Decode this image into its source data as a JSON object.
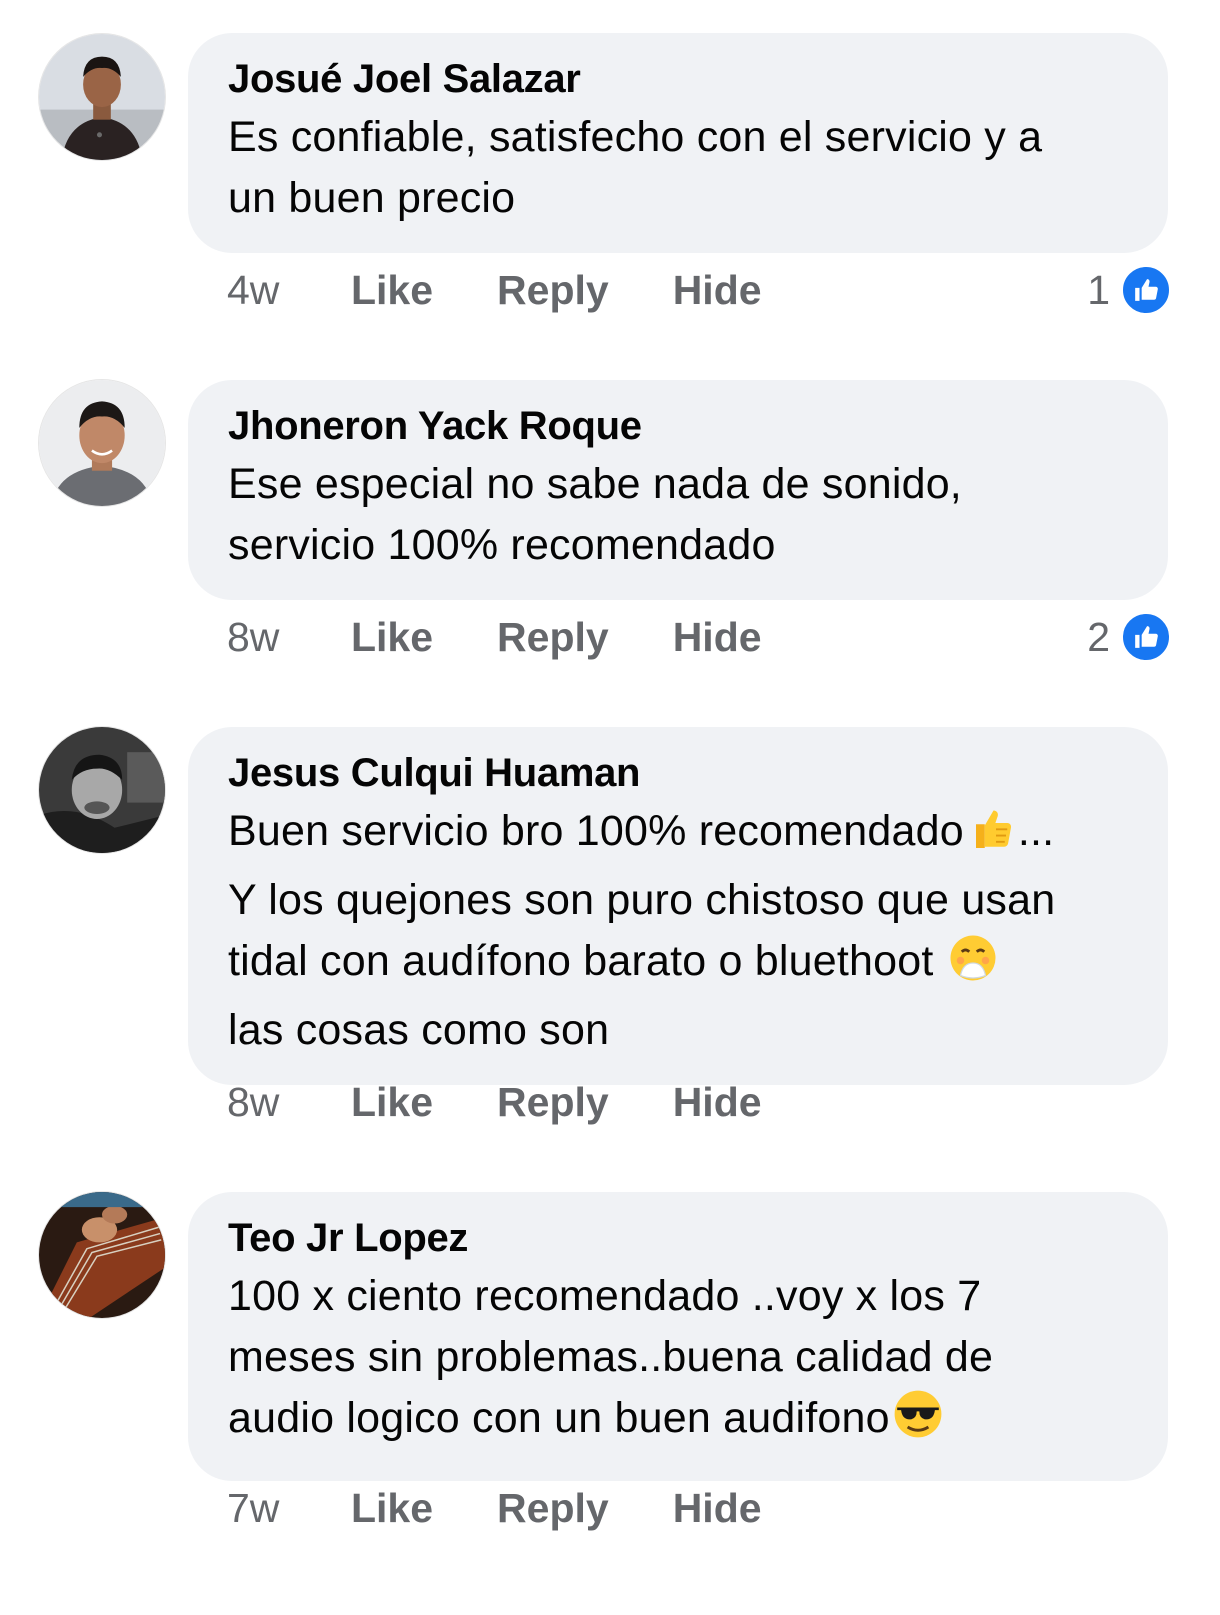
{
  "comments": [
    {
      "author": "Josué Joel Salazar",
      "lines": [
        "Es confiable, satisfecho con el servicio y a",
        "un buen precio"
      ],
      "time": "4w",
      "like": "Like",
      "reply": "Reply",
      "hide": "Hide",
      "reaction_count": "1"
    },
    {
      "author": "Jhoneron Yack Roque",
      "lines": [
        "Ese especial no sabe nada de sonido,",
        "servicio 100% recomendado"
      ],
      "time": "8w",
      "like": "Like",
      "reply": "Reply",
      "hide": "Hide",
      "reaction_count": "2"
    },
    {
      "author": "Jesus Culqui Huaman",
      "lines": [
        "Buen servicio bro 100% recomendado",
        "...",
        "Y los quejones son puro chistoso que usan",
        "tidal con audífono barato o bluethoot",
        "las cosas como son"
      ],
      "time": "8w",
      "like": "Like",
      "reply": "Reply",
      "hide": "Hide"
    },
    {
      "author": "Teo Jr Lopez",
      "lines": [
        "100 x ciento recomendado ..voy x los 7",
        "meses sin problemas..buena calidad de",
        "audio logico con un buen audifono"
      ],
      "time": "7w",
      "like": "Like",
      "reply": "Reply",
      "hide": "Hide"
    }
  ],
  "colors": {
    "bubble": "#f0f2f5",
    "meta_text": "#65676b",
    "like_blue": "#1877f2"
  },
  "icons": [
    "like-reaction-icon",
    "thumbs-up-emoji-icon",
    "hand-over-mouth-emoji-icon",
    "sunglasses-emoji-icon"
  ]
}
